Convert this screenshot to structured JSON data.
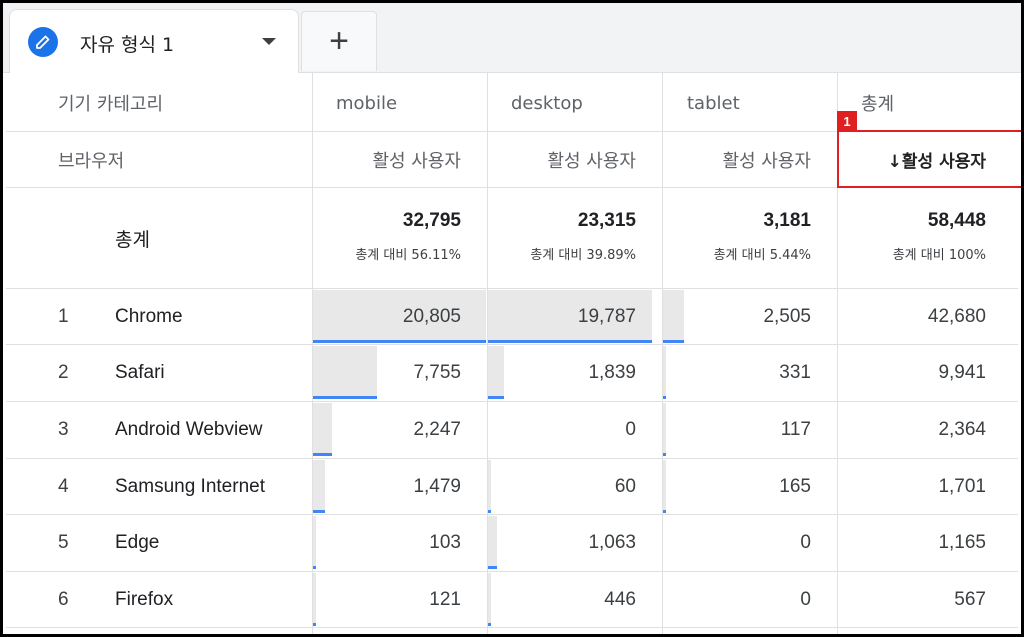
{
  "tab": {
    "title": "자유 형식 1",
    "add_label": "+"
  },
  "header": {
    "row_dim_label": "기기 카테고리",
    "columns": [
      "mobile",
      "desktop",
      "tablet",
      "총계"
    ],
    "sub_dim_label": "브라우저",
    "metric_labels": [
      "활성 사용자",
      "활성 사용자",
      "활성 사용자",
      "↓활성 사용자"
    ],
    "sort_badge": "1"
  },
  "totals": {
    "label": "총계",
    "values": [
      "32,795",
      "23,315",
      "3,181",
      "58,448"
    ],
    "percents": [
      "총계 대비 56.11%",
      "총계 대비 39.89%",
      "총계 대비 5.44%",
      "총계 대비 100%"
    ]
  },
  "rows": [
    {
      "rank": "1",
      "browser": "Chrome",
      "mobile": "20,805",
      "desktop": "19,787",
      "tablet": "2,505",
      "total": "42,680",
      "bar": {
        "mobile": 1.0,
        "desktop": 0.95,
        "tablet": 0.12
      }
    },
    {
      "rank": "2",
      "browser": "Safari",
      "mobile": "7,755",
      "desktop": "1,839",
      "tablet": "331",
      "total": "9,941",
      "bar": {
        "mobile": 0.37,
        "desktop": 0.09,
        "tablet": 0.016
      }
    },
    {
      "rank": "3",
      "browser": "Android Webview",
      "mobile": "2,247",
      "desktop": "0",
      "tablet": "117",
      "total": "2,364",
      "bar": {
        "mobile": 0.11,
        "desktop": 0,
        "tablet": 0.006
      }
    },
    {
      "rank": "4",
      "browser": "Samsung Internet",
      "mobile": "1,479",
      "desktop": "60",
      "tablet": "165",
      "total": "1,701",
      "bar": {
        "mobile": 0.07,
        "desktop": 0.003,
        "tablet": 0.008
      }
    },
    {
      "rank": "5",
      "browser": "Edge",
      "mobile": "103",
      "desktop": "1,063",
      "tablet": "0",
      "total": "1,165",
      "bar": {
        "mobile": 0.005,
        "desktop": 0.05,
        "tablet": 0
      }
    },
    {
      "rank": "6",
      "browser": "Firefox",
      "mobile": "121",
      "desktop": "446",
      "tablet": "0",
      "total": "567",
      "bar": {
        "mobile": 0.006,
        "desktop": 0.02,
        "tablet": 0
      }
    }
  ],
  "colors": {
    "accent": "#1a73e8",
    "bar": "#4285f4",
    "highlight": "#e02020"
  }
}
